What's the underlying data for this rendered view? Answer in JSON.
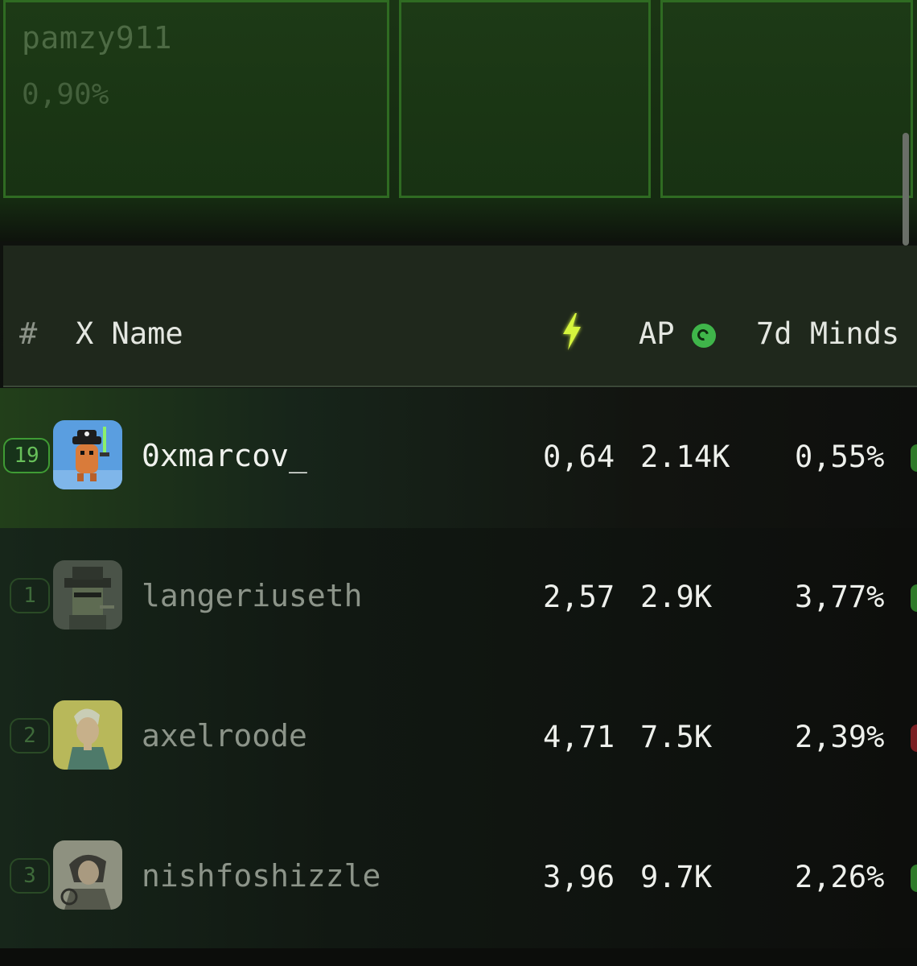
{
  "top_cards": [
    {
      "name": "pamzy911",
      "pct": "0,90%"
    },
    {
      "name": "",
      "pct": ""
    },
    {
      "name": "",
      "pct": ""
    }
  ],
  "table": {
    "headers": {
      "rank": "#",
      "name": "X Name",
      "ap": "AP",
      "mindshare": "7d Minds"
    },
    "rows": [
      {
        "rank": "19",
        "name": "0xmarcov_",
        "bolt": "0,64",
        "ap": "2.14K",
        "mindshare": "0,55%",
        "trend": "up",
        "highlight": true
      },
      {
        "rank": "1",
        "name": "langeriuseth",
        "bolt": "2,57",
        "ap": "2.9K",
        "mindshare": "3,77%",
        "trend": "up",
        "highlight": false
      },
      {
        "rank": "2",
        "name": "axelroode",
        "bolt": "4,71",
        "ap": "7.5K",
        "mindshare": "2,39%",
        "trend": "down",
        "highlight": false
      },
      {
        "rank": "3",
        "name": "nishfoshizzle",
        "bolt": "3,96",
        "ap": "9.7K",
        "mindshare": "2,26%",
        "trend": "up",
        "highlight": false
      }
    ]
  },
  "colors": {
    "accent": "#4fbf3f",
    "bolt": "#d6f53c",
    "down": "#7a1f22"
  },
  "icons": {
    "bolt": "lightning-bolt-icon",
    "ap_badge": "ap-badge-icon"
  }
}
